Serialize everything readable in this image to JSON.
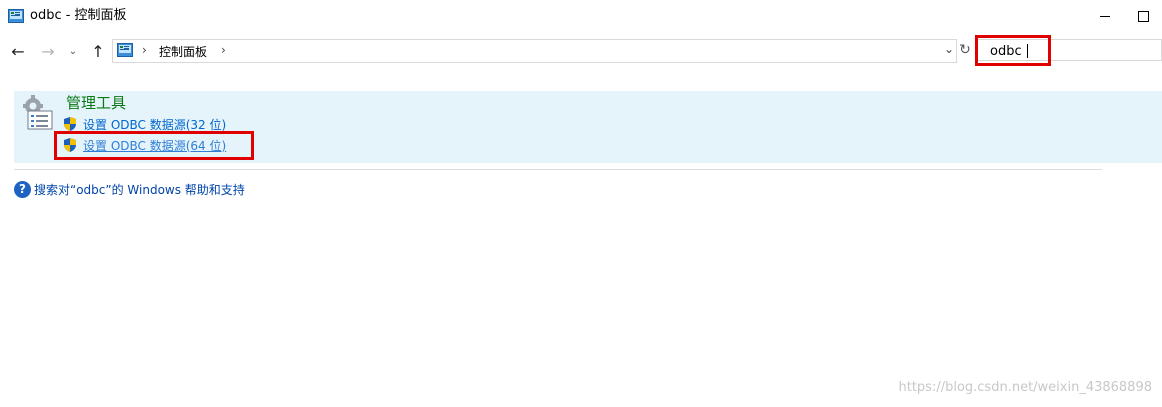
{
  "window": {
    "title": "odbc - 控制面板",
    "icon": "control-panel-icon"
  },
  "navigation": {
    "back_icon": "←",
    "forward_icon": "→",
    "recent_icon": "⌄",
    "up_icon": "↑",
    "breadcrumb_separator": "›",
    "breadcrumb": "控制面板",
    "dropdown_icon": "⌄",
    "refresh_icon": "↻"
  },
  "search": {
    "value": "odbc"
  },
  "results": {
    "group_title": "管理工具",
    "group_icon": "administrative-tools-icon",
    "tasks": [
      {
        "label": "设置 ODBC 数据源(32 位)",
        "icon": "uac-shield-icon"
      },
      {
        "label": "设置 ODBC 数据源(64 位)",
        "icon": "uac-shield-icon"
      }
    ]
  },
  "help": {
    "icon_glyph": "?",
    "link": "搜索对“odbc”的 Windows 帮助和支持"
  },
  "watermark": "https://blog.csdn.net/weixin_43868898",
  "colors": {
    "highlight_box": "#e00000",
    "result_panel_bg": "#e5f3fb",
    "group_title": "#0a7a17",
    "link": "#0066cc"
  }
}
